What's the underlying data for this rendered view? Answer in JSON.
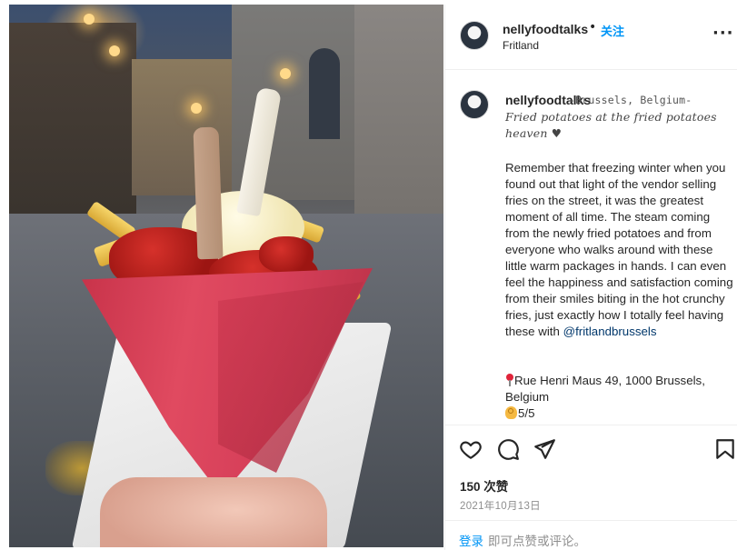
{
  "post": {
    "username": "nellyfoodtalks",
    "separator": "•",
    "follow_label": "关注",
    "location": "Fritland",
    "more_icon": "more-horizontal-icon",
    "image_alt": "Fries in a red paper cone with ketchup and mayonnaise"
  },
  "caption": {
    "username": "nellyfoodtalks",
    "title": "-Brussels, Belgium-",
    "subtitle": "Fried potatoes at the fried potatoes heaven ♥",
    "body_before_mention": "Remember that freezing winter when you found out that light of the vendor selling fries on the street, it was the greatest moment of all time. The steam coming from the newly fried potatoes and from everyone who walks around with these little warm packages in hands. I can even feel the happiness and satisfaction coming from their smiles biting in the hot crunchy fries, just exactly how I totally feel having these with ",
    "mention": "@fritlandbrussels",
    "address": "Rue Henri Maus 49, 1000 Brussels, Belgium",
    "rating": "5/5"
  },
  "actions": {
    "like_icon": "heart-icon",
    "comment_icon": "comment-icon",
    "share_icon": "paper-plane-icon",
    "save_icon": "bookmark-icon",
    "likes": "150 次赞",
    "date": "2021年10月13日",
    "login_label": "登录",
    "login_tail": "即可点赞或评论。"
  }
}
